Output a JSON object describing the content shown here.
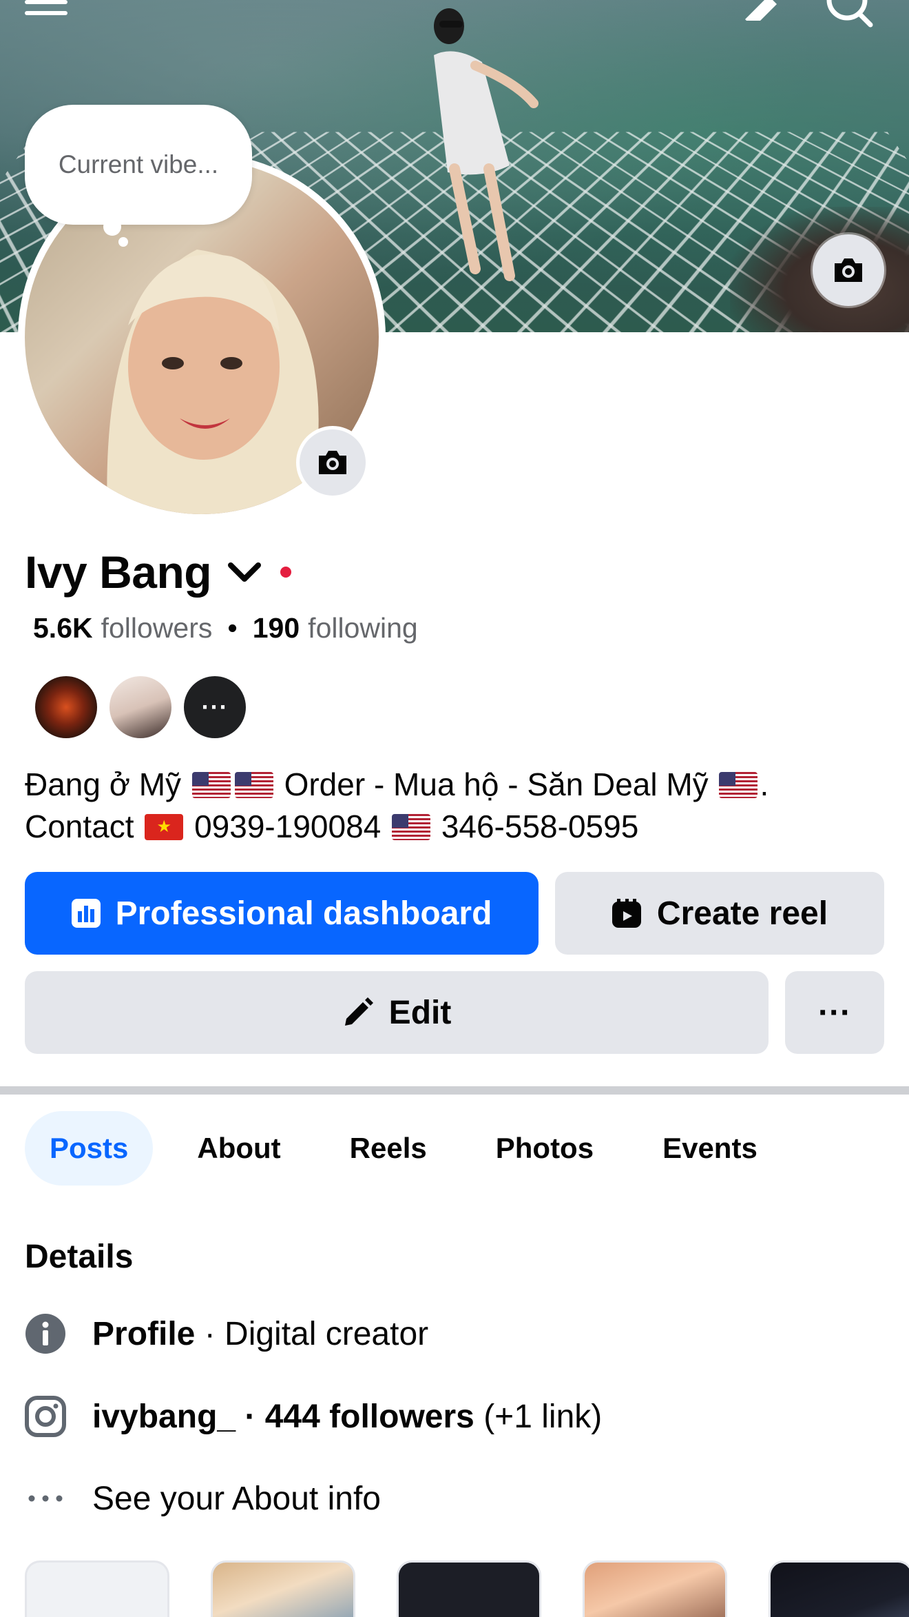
{
  "cover": {
    "bubble_text": "Current vibe..."
  },
  "profile": {
    "name": "Ivy Bang",
    "followers_count": "5.6K",
    "followers_label": "followers",
    "following_count": "190",
    "following_label": "following",
    "friends_more": "···",
    "bio_line1_a": "Đang ở Mỹ",
    "bio_line1_b": "Order - Mua hộ - Săn Deal Mỹ",
    "bio_line1_c": ".",
    "bio_line2_a": "Contact",
    "bio_line2_b": "0939-190084",
    "bio_line2_c": "346-558-0595"
  },
  "actions": {
    "professional_dashboard": "Professional dashboard",
    "create_reel": "Create reel",
    "edit": "Edit",
    "more": "···"
  },
  "tabs": [
    {
      "label": "Posts",
      "active": true
    },
    {
      "label": "About"
    },
    {
      "label": "Reels"
    },
    {
      "label": "Photos"
    },
    {
      "label": "Events"
    }
  ],
  "details": {
    "title": "Details",
    "profile_label": "Profile",
    "profile_value": " · Digital creator",
    "instagram_handle": "ivybang_",
    "instagram_followers": " · 444 followers",
    "instagram_links": " (+1 link)",
    "about_info": "See your About info"
  },
  "colors": {
    "accent": "#0866ff",
    "button_gray": "#e4e6eb",
    "active_tab_bg": "#ebf5ff",
    "status_dot": "#e41e3f"
  }
}
